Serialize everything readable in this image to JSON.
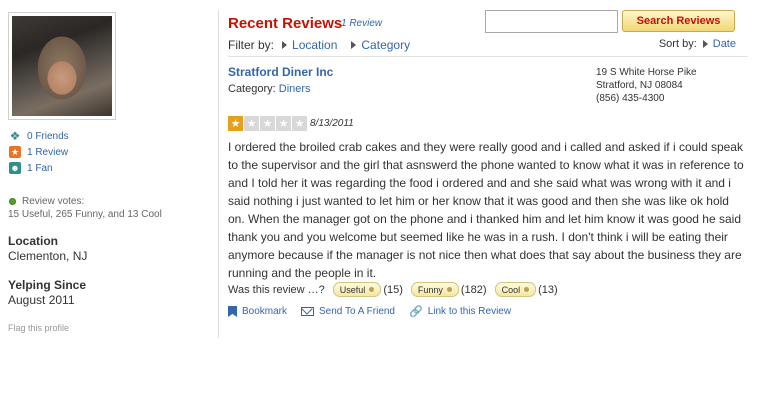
{
  "profile": {
    "friends": "0 Friends",
    "reviews": "1 Review",
    "fans": "1 Fan",
    "votes_label": "Review votes:",
    "votes_value": "15 Useful, 265 Funny, and 13 Cool",
    "location_label": "Location",
    "location_value": "Clementon, NJ",
    "since_label": "Yelping Since",
    "since_value": "August 2011",
    "flag": "Flag this profile"
  },
  "header": {
    "title": "Recent Reviews",
    "count": "1 Review",
    "search_placeholder": "",
    "search_button": "Search Reviews"
  },
  "filter": {
    "label": "Filter by:",
    "location": "Location",
    "category": "Category"
  },
  "sort": {
    "label": "Sort by:",
    "value": "Date"
  },
  "review": {
    "business": "Stratford Diner Inc",
    "category_label": "Category:",
    "category": "Diners",
    "address_line1": "19 S White Horse Pike",
    "address_line2": "Stratford, NJ 08084",
    "phone": "(856) 435-4300",
    "rating": 1,
    "rating_max": 5,
    "date": "8/13/2011",
    "text": "I ordered the broiled crab cakes and they were really good and i called and asked if i could speak to the supervisor and the girl that asnswerd the phone wanted to know what it was in reference to and I told her it was regarding the food i ordered and and she said what was wrong with it and i said nothing i just wanted to let him or her know that it was good and then she was like ok hold on. When the manager got on the phone and i thanked him and let him know it was good he said thank you and you welcome but seemed like he was in a rush. I don't think i will be eating their anymore because if the manager is not nice then what does that say about the business they are running and the people in it.",
    "was_useful": "Was this review …?",
    "useful_label": "Useful",
    "useful_count": "(15)",
    "funny_label": "Funny",
    "funny_count": "(182)",
    "cool_label": "Cool",
    "cool_count": "(13)"
  },
  "actions": {
    "bookmark": "Bookmark",
    "send": "Send To A Friend",
    "link": "Link to this Review"
  },
  "colors": {
    "title_red": "#c41200",
    "link_blue": "#3366aa",
    "star_orange": "#e6a11c"
  }
}
